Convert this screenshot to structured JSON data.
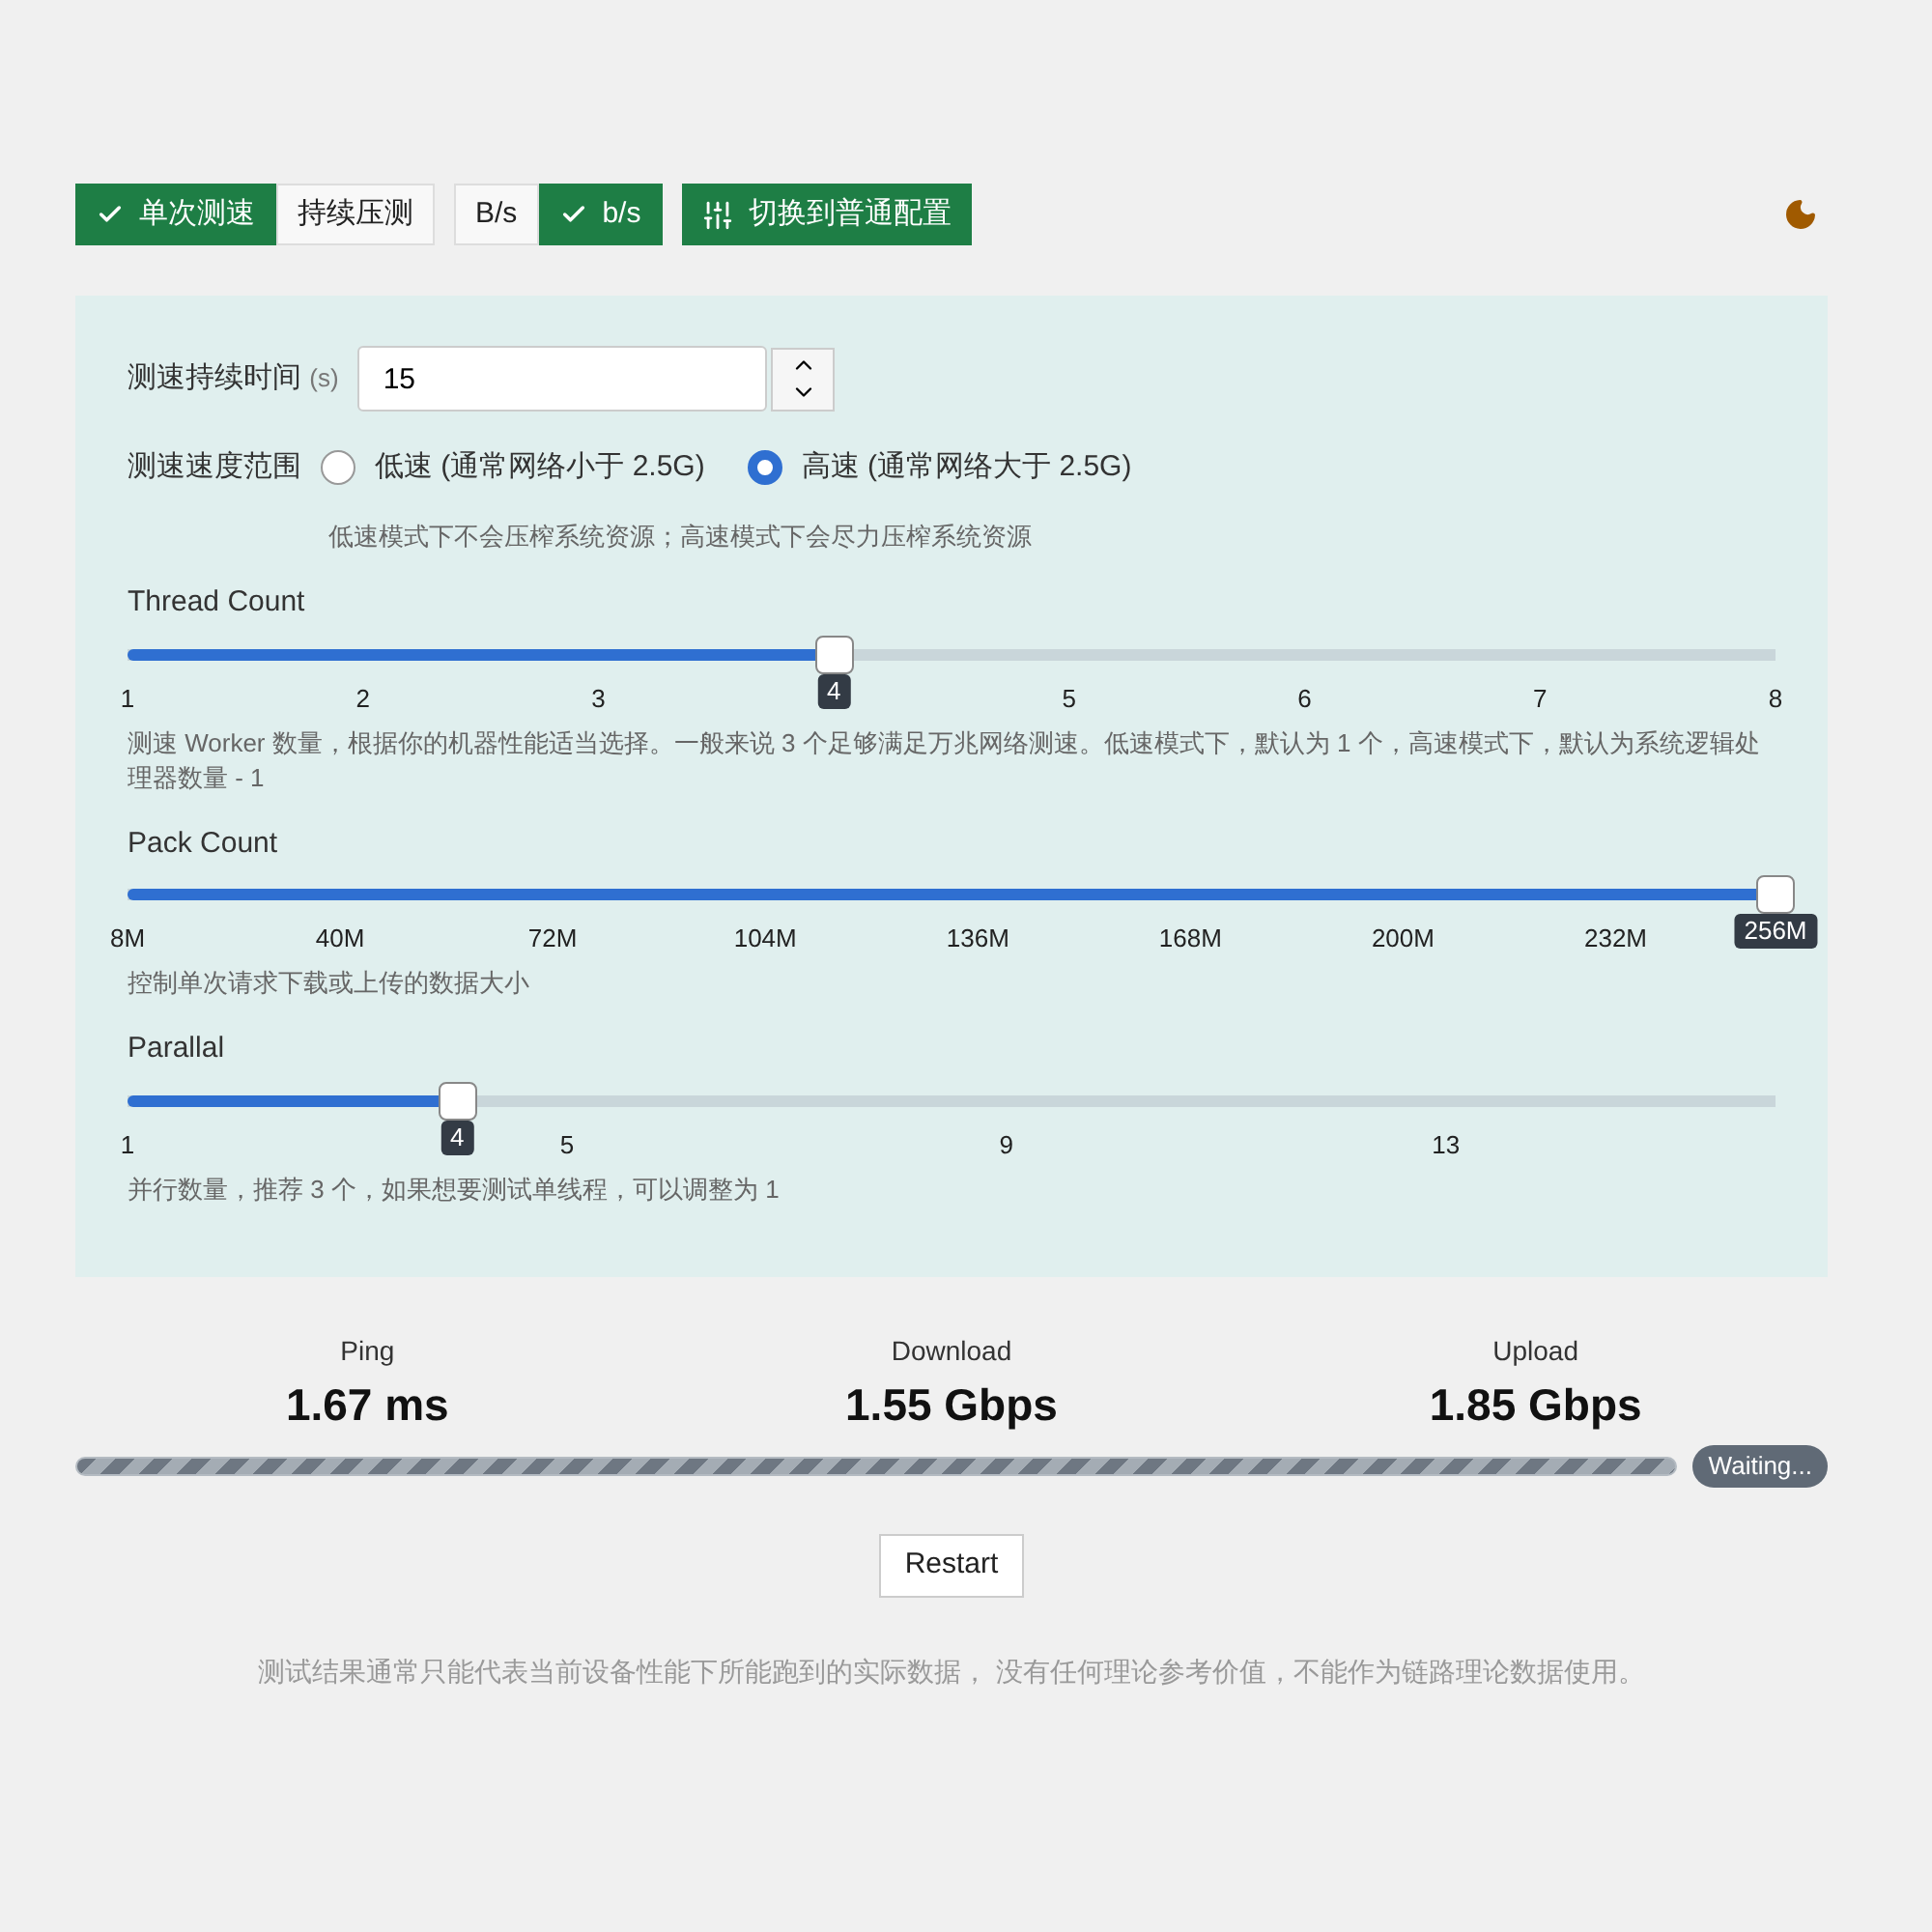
{
  "mode_toggle": [
    {
      "label": "单次测速",
      "selected": true
    },
    {
      "label": "持续压测",
      "selected": false
    }
  ],
  "unit_toggle": [
    {
      "label": "B/s",
      "selected": false
    },
    {
      "label": "b/s",
      "selected": true
    }
  ],
  "switch_button": {
    "label": "切换到普通配置"
  },
  "settings": {
    "duration": {
      "label": "测速持续时间",
      "unit": "(s)",
      "value": "15"
    },
    "speed_range": {
      "label": "测速速度范围",
      "options": [
        {
          "label": "低速 (通常网络小于 2.5G)",
          "selected": false
        },
        {
          "label": "高速 (通常网络大于 2.5G)",
          "selected": true
        }
      ],
      "hint": "低速模式下不会压榨系统资源；高速模式下会尽力压榨系统资源"
    },
    "sliders": [
      {
        "label": "Thread Count",
        "level": 0.4286,
        "value": "4",
        "ticks": [
          {
            "label": "1",
            "level": 0
          },
          {
            "label": "2",
            "level": 0.1429
          },
          {
            "label": "3",
            "level": 0.2857
          },
          {
            "label": "5",
            "level": 0.5714
          },
          {
            "label": "6",
            "level": 0.7143
          },
          {
            "label": "7",
            "level": 0.8571
          },
          {
            "label": "8",
            "level": 1
          }
        ],
        "hint": "测速 Worker 数量，根据你的机器性能适当选择。一般来说 3 个足够满足万兆网络测速。低速模式下，默认为 1 个，高速模式下，默认为系统逻辑处理器数量 - 1"
      },
      {
        "label": "Pack Count",
        "level": 1,
        "value": "256M",
        "ticks": [
          {
            "label": "8M",
            "level": 0
          },
          {
            "label": "40M",
            "level": 0.129
          },
          {
            "label": "72M",
            "level": 0.258
          },
          {
            "label": "104M",
            "level": 0.387
          },
          {
            "label": "136M",
            "level": 0.516
          },
          {
            "label": "168M",
            "level": 0.645
          },
          {
            "label": "200M",
            "level": 0.774
          },
          {
            "label": "232M",
            "level": 0.903
          }
        ],
        "hint": "控制单次请求下载或上传的数据大小"
      },
      {
        "label": "Parallal",
        "level": 0.2,
        "value": "4",
        "ticks": [
          {
            "label": "1",
            "level": 0
          },
          {
            "label": "5",
            "level": 0.2667
          },
          {
            "label": "9",
            "level": 0.5333
          },
          {
            "label": "13",
            "level": 0.8
          }
        ],
        "hint": "并行数量，推荐 3 个，如果想要测试单线程，可以调整为 1"
      }
    ]
  },
  "results": [
    {
      "label": "Ping",
      "value": "1.67 ms"
    },
    {
      "label": "Download",
      "value": "1.55 Gbps"
    },
    {
      "label": "Upload",
      "value": "1.85 Gbps"
    }
  ],
  "progress": {
    "level": 1,
    "status": "Waiting..."
  },
  "restart_button": "Restart",
  "disclaimer": "测试结果通常只能代表当前设备性能下所能跑到的实际数据， 没有任何理论参考价值，不能作为链路理论数据使用。"
}
